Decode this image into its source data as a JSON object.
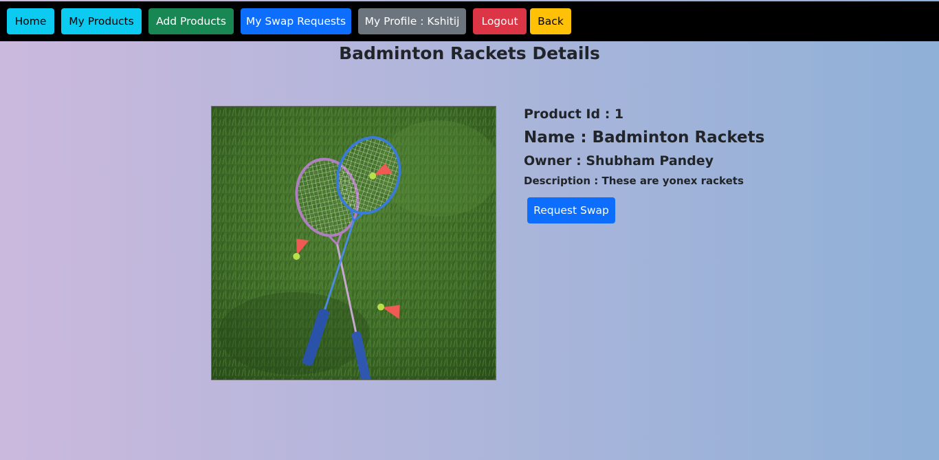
{
  "nav": {
    "home": "Home",
    "my_products": "My Products",
    "add_products": "Add Products",
    "my_swap_requests": "My Swap Requests",
    "my_profile": "My Profile : Kshitij",
    "logout": "Logout",
    "back": "Back"
  },
  "page": {
    "title": "Badminton Rackets Details"
  },
  "product": {
    "id_text": "Product Id : 1",
    "name_text": "Name : Badminton Rackets",
    "owner_text": "Owner : Shubham Pandey",
    "description_text": "Description : These are yonex rackets",
    "request_swap_label": "Request Swap"
  },
  "colors": {
    "info": "#0dcaf0",
    "success": "#198754",
    "primary": "#0d6efd",
    "secondary": "#6c757d",
    "danger": "#dc3545",
    "warning": "#ffc107",
    "navbar": "#000000"
  }
}
